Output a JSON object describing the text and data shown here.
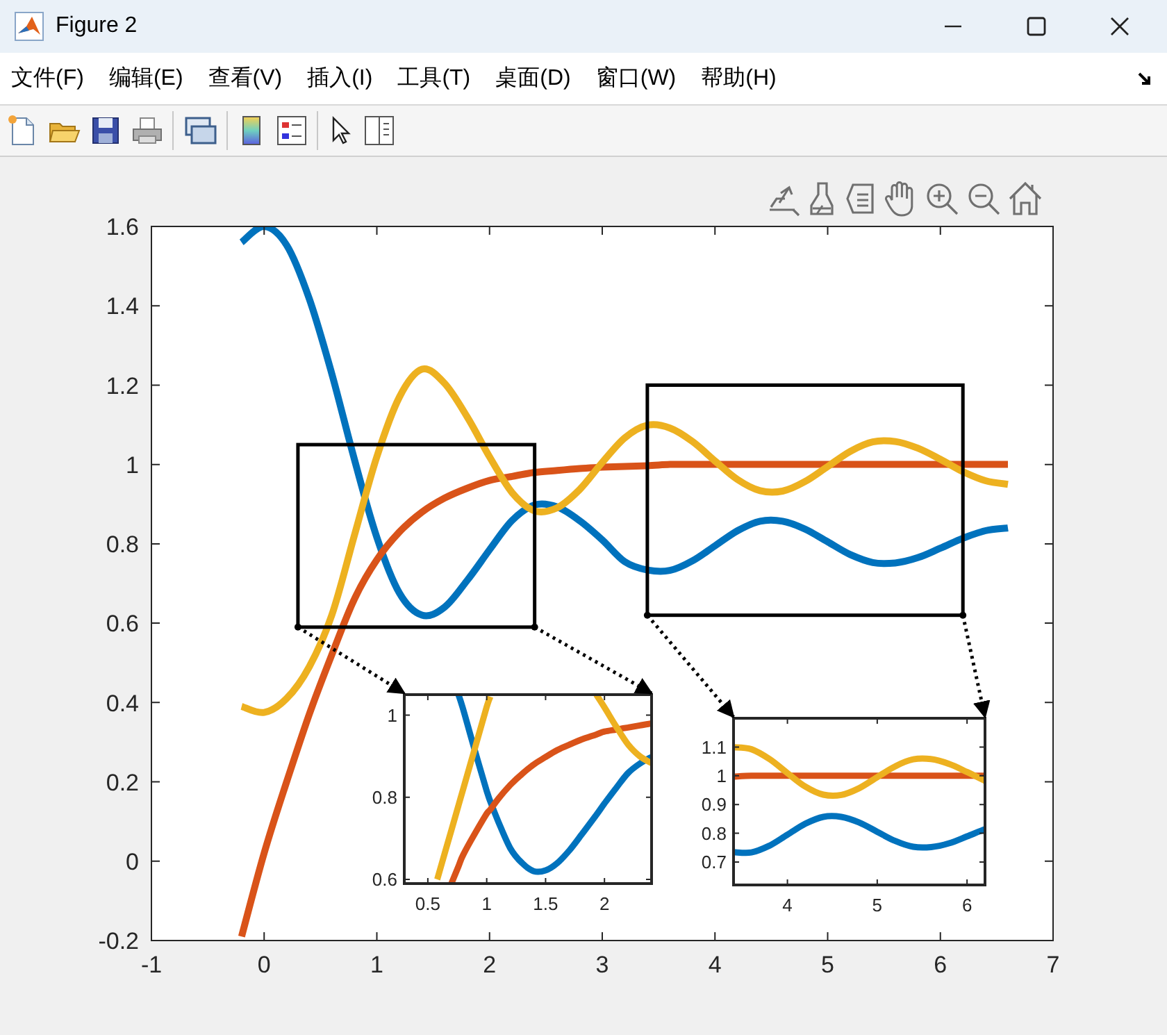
{
  "window": {
    "title": "Figure 2"
  },
  "menu_bar": [
    {
      "label": "文件(F)"
    },
    {
      "label": "编辑(E)"
    },
    {
      "label": "查看(V)"
    },
    {
      "label": "插入(I)"
    },
    {
      "label": "工具(T)"
    },
    {
      "label": "桌面(D)"
    },
    {
      "label": "窗口(W)"
    },
    {
      "label": "帮助(H)"
    }
  ],
  "axes": {
    "chart_data": {
      "type": "line",
      "x": [
        -0.2,
        0,
        0.2,
        0.4,
        0.6,
        0.8,
        1,
        1.2,
        1.4,
        1.6,
        1.8,
        2,
        2.2,
        2.4,
        2.6,
        2.8,
        3,
        3.2,
        3.4,
        3.6,
        3.8,
        4,
        4.2,
        4.4,
        4.6,
        4.8,
        5,
        5.2,
        5.4,
        5.6,
        5.8,
        6,
        6.2,
        6.4,
        6.6
      ],
      "series": [
        {
          "color": "#0072bd",
          "values": [
            1.56,
            1.6,
            1.553,
            1.418,
            1.229,
            1.014,
            0.816,
            0.676,
            0.62,
            0.64,
            0.707,
            0.785,
            0.859,
            0.898,
            0.893,
            0.858,
            0.81,
            0.755,
            0.734,
            0.733,
            0.757,
            0.795,
            0.833,
            0.857,
            0.857,
            0.837,
            0.805,
            0.773,
            0.753,
            0.752,
            0.765,
            0.789,
            0.814,
            0.833,
            0.84
          ]
        },
        {
          "color": "#d95319",
          "values": [
            -0.19,
            0.02,
            0.2,
            0.37,
            0.52,
            0.66,
            0.76,
            0.83,
            0.88,
            0.915,
            0.94,
            0.96,
            0.97,
            0.98,
            0.985,
            0.99,
            0.993,
            0.995,
            0.997,
            1,
            1,
            1,
            1,
            1,
            1,
            1,
            1,
            1,
            1,
            1,
            1,
            1,
            1,
            1,
            1
          ]
        },
        {
          "color": "#edb120",
          "values": [
            0.39,
            0.375,
            0.41,
            0.49,
            0.62,
            0.82,
            1.02,
            1.17,
            1.24,
            1.205,
            1.121,
            1.019,
            0.929,
            0.883,
            0.891,
            0.937,
            1.005,
            1.067,
            1.099,
            1.092,
            1.058,
            1.009,
            0.962,
            0.934,
            0.933,
            0.957,
            0.995,
            1.033,
            1.057,
            1.058,
            1.041,
            1.013,
            0.982,
            0.959,
            0.95
          ]
        }
      ],
      "xlim": [
        -1,
        7
      ],
      "ylim": [
        -0.2,
        1.6
      ],
      "xticks": [
        -1,
        0,
        1,
        2,
        3,
        4,
        5,
        6,
        7
      ],
      "yticks": [
        -0.2,
        0,
        0.2,
        0.4,
        0.6,
        0.8,
        1,
        1.2,
        1.4,
        1.6
      ]
    }
  },
  "insets": [
    {
      "chart_data": {
        "type": "line",
        "x": [
          0.58,
          0.6,
          0.7,
          0.76,
          0.8,
          0.9,
          1,
          1.03,
          1.1,
          1.2,
          1.3,
          1.4,
          1.5,
          1.6,
          1.7,
          1.8,
          1.93,
          2,
          2.1,
          2.2,
          2.3,
          2.4
        ],
        "series": [
          {
            "color": "#0072bd",
            "values": [
              null,
              null,
              null,
              1.05,
              1.014,
              0.913,
              0.816,
              0.79,
              0.74,
              0.676,
              0.64,
              0.62,
              0.622,
              0.64,
              0.67,
              0.707,
              0.757,
              0.785,
              0.823,
              0.859,
              0.882,
              0.898
            ]
          },
          {
            "color": "#d95319",
            "values": [
              null,
              null,
              0.59,
              0.632,
              0.66,
              0.712,
              0.76,
              0.77,
              0.797,
              0.83,
              0.857,
              0.88,
              0.898,
              0.915,
              0.928,
              0.94,
              0.953,
              0.96,
              0.965,
              0.97,
              0.975,
              0.98
            ]
          },
          {
            "color": "#edb120",
            "values": [
              0.6,
              0.62,
              0.72,
              0.78,
              0.82,
              0.92,
              1.02,
              1.045,
              null,
              null,
              null,
              null,
              null,
              null,
              null,
              null,
              1.05,
              1.019,
              0.972,
              0.929,
              0.9,
              0.883
            ]
          }
        ],
        "xlim": [
          0.3,
          2.4
        ],
        "ylim": [
          0.59,
          1.05
        ],
        "xticks": [
          0.5,
          1,
          1.5,
          2
        ],
        "yticks": [
          0.6,
          0.8,
          1
        ]
      }
    },
    {
      "chart_data": {
        "type": "line",
        "x": [
          3.4,
          3.6,
          3.8,
          4,
          4.2,
          4.4,
          4.6,
          4.8,
          5,
          5.2,
          5.4,
          5.6,
          5.8,
          6,
          6.2
        ],
        "series": [
          {
            "color": "#0072bd",
            "values": [
              0.734,
              0.733,
              0.757,
              0.795,
              0.833,
              0.857,
              0.857,
              0.837,
              0.805,
              0.773,
              0.753,
              0.752,
              0.765,
              0.789,
              0.814
            ]
          },
          {
            "color": "#d95319",
            "values": [
              0.997,
              1,
              1,
              1,
              1,
              1,
              1,
              1,
              1,
              1,
              1,
              1,
              1,
              1,
              1
            ]
          },
          {
            "color": "#edb120",
            "values": [
              1.099,
              1.092,
              1.058,
              1.009,
              0.962,
              0.934,
              0.933,
              0.957,
              0.995,
              1.033,
              1.057,
              1.058,
              1.041,
              1.013,
              0.982
            ]
          }
        ],
        "xlim": [
          3.4,
          6.2
        ],
        "ylim": [
          0.62,
          1.2
        ],
        "xticks": [
          4,
          5,
          6
        ],
        "yticks": [
          0.7,
          0.8,
          0.9,
          1,
          1.1
        ]
      }
    }
  ]
}
